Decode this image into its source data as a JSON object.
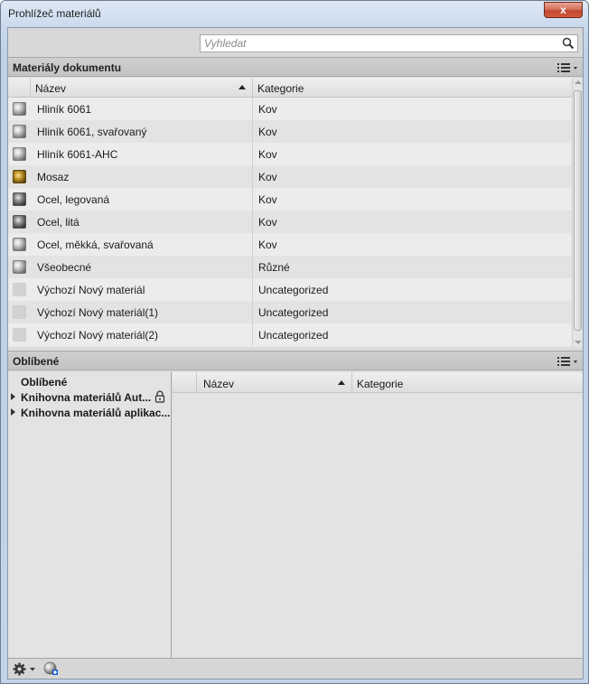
{
  "window": {
    "title": "Prohlížeč materiálů",
    "close_glyph": "x"
  },
  "search": {
    "placeholder": "Vyhledat",
    "value": "",
    "icon": "search-icon"
  },
  "document_materials": {
    "title": "Materiály dokumentu",
    "columns": {
      "name": "Název",
      "category": "Kategorie"
    },
    "rows": [
      {
        "name": "Hliník 6061",
        "category": "Kov",
        "swatch": "metal"
      },
      {
        "name": "Hliník 6061, svařovaný",
        "category": "Kov",
        "swatch": "metal"
      },
      {
        "name": "Hliník 6061-AHC",
        "category": "Kov",
        "swatch": "metal"
      },
      {
        "name": "Mosaz",
        "category": "Kov",
        "swatch": "brass"
      },
      {
        "name": "Ocel, legovaná",
        "category": "Kov",
        "swatch": "dark-metal"
      },
      {
        "name": "Ocel, litá",
        "category": "Kov",
        "swatch": "dark-metal"
      },
      {
        "name": "Ocel, měkká, svařovaná",
        "category": "Kov",
        "swatch": "metal"
      },
      {
        "name": "Všeobecné",
        "category": "Různé",
        "swatch": "metal"
      },
      {
        "name": "Výchozí Nový materiál",
        "category": "Uncategorized",
        "swatch": "blank"
      },
      {
        "name": "Výchozí Nový materiál(1)",
        "category": "Uncategorized",
        "swatch": "blank"
      },
      {
        "name": "Výchozí Nový materiál(2)",
        "category": "Uncategorized",
        "swatch": "blank"
      }
    ]
  },
  "favorites": {
    "title": "Oblíbené",
    "tree": [
      {
        "label": "Oblíbené",
        "expandable": false,
        "locked": false
      },
      {
        "label": "Knihovna materiálů Aut...",
        "expandable": true,
        "locked": true
      },
      {
        "label": "Knihovna materiálů aplikac...",
        "expandable": true,
        "locked": false
      }
    ],
    "columns": {
      "name": "Název",
      "category": "Kategorie"
    }
  },
  "colors": {
    "accent": "#c24a32",
    "panel": "#dcdcdc",
    "header": "#c3c3c3"
  }
}
